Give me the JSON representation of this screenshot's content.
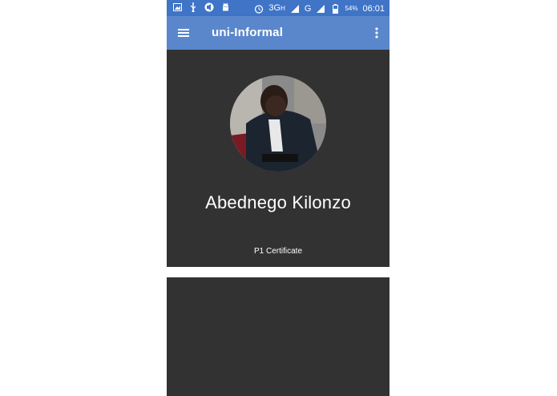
{
  "status_bar": {
    "network_3g": "3G",
    "network_3g_sub": "H",
    "network_g": "G",
    "battery": "54%",
    "time": "06:01"
  },
  "app_bar": {
    "title": "uni-Informal",
    "menu_icon": "hamburger-menu-icon",
    "overflow_icon": "more-vert-icon"
  },
  "profile": {
    "name": "Abednego Kilonzo",
    "certificate": "P1 Certificate"
  },
  "colors": {
    "status_bar": "#3f74c6",
    "app_bar": "#5a87cc",
    "card_background": "#323232"
  }
}
